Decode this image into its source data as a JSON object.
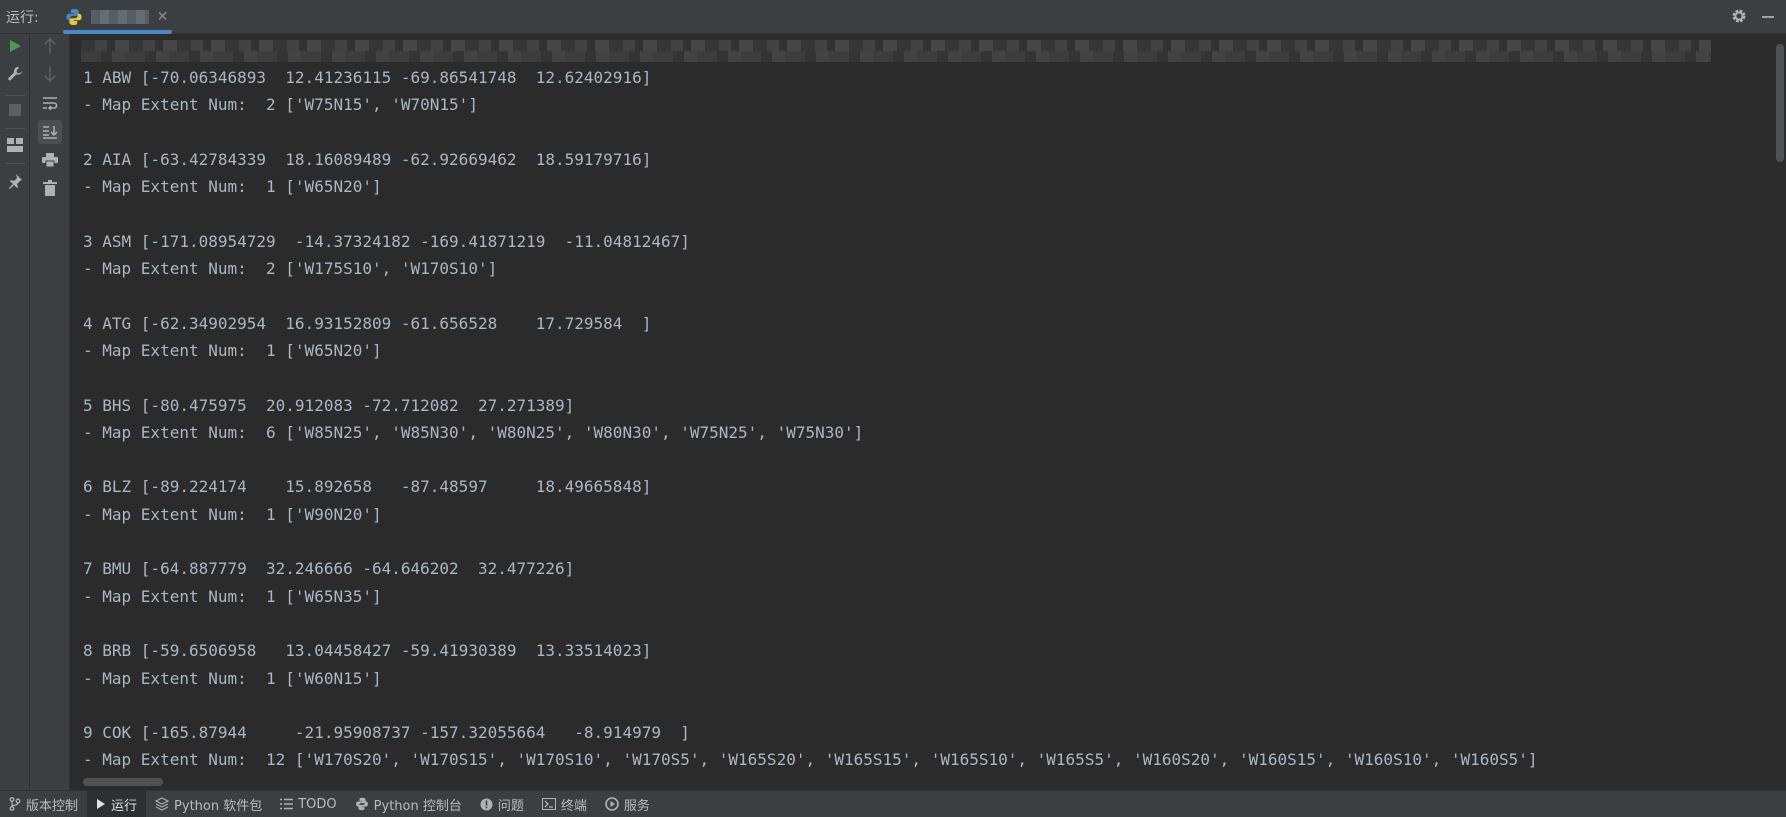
{
  "topbar": {
    "run_label": "运行:",
    "tab_icon": "python-icon"
  },
  "toolbar_left": [
    "run-icon",
    "wrench-icon",
    "stop-icon",
    "layout-icon",
    "pin-icon"
  ],
  "toolbar_right": [
    "arrow-up-icon",
    "arrow-down-icon",
    "soft-wrap-icon",
    "scroll-to-end-icon",
    "print-icon",
    "trash-icon"
  ],
  "console": {
    "lines": [
      "1 ABW [-70.06346893  12.41236115 -69.86541748  12.62402916]",
      "- Map Extent Num:  2 ['W75N15', 'W70N15']",
      "",
      "2 AIA [-63.42784339  18.16089489 -62.92669462  18.59179716]",
      "- Map Extent Num:  1 ['W65N20']",
      "",
      "3 ASM [-171.08954729  -14.37324182 -169.41871219  -11.04812467]",
      "- Map Extent Num:  2 ['W175S10', 'W170S10']",
      "",
      "4 ATG [-62.34902954  16.93152809 -61.656528    17.729584  ]",
      "- Map Extent Num:  1 ['W65N20']",
      "",
      "5 BHS [-80.475975  20.912083 -72.712082  27.271389]",
      "- Map Extent Num:  6 ['W85N25', 'W85N30', 'W80N25', 'W80N30', 'W75N25', 'W75N30']",
      "",
      "6 BLZ [-89.224174    15.892658   -87.48597     18.49665848]",
      "- Map Extent Num:  1 ['W90N20']",
      "",
      "7 BMU [-64.887779  32.246666 -64.646202  32.477226]",
      "- Map Extent Num:  1 ['W65N35']",
      "",
      "8 BRB [-59.6506958   13.04458427 -59.41930389  13.33514023]",
      "- Map Extent Num:  1 ['W60N15']",
      "",
      "9 COK [-165.87944     -21.95908737 -157.32055664   -8.914979  ]",
      "- Map Extent Num:  12 ['W170S20', 'W170S15', 'W170S10', 'W170S5', 'W165S20', 'W165S15', 'W165S10', 'W165S5', 'W160S20', 'W160S15', 'W160S10', 'W160S5']"
    ]
  },
  "bottom_tabs": [
    {
      "label": "版本控制",
      "icon": "branch-icon"
    },
    {
      "label": "运行",
      "icon": "run-icon"
    },
    {
      "label": "Python 软件包",
      "icon": "packages-icon"
    },
    {
      "label": "TODO",
      "icon": "list-icon"
    },
    {
      "label": "Python 控制台",
      "icon": "python-icon"
    },
    {
      "label": "问题",
      "icon": "warning-icon"
    },
    {
      "label": "终端",
      "icon": "terminal-icon"
    },
    {
      "label": "服务",
      "icon": "services-icon"
    }
  ],
  "colors": {
    "background": "#2b2b2b",
    "panel": "#3c3f41",
    "text": "#a9b7c6",
    "run_green": "#499c54",
    "accent_blue": "#4a88c7"
  }
}
